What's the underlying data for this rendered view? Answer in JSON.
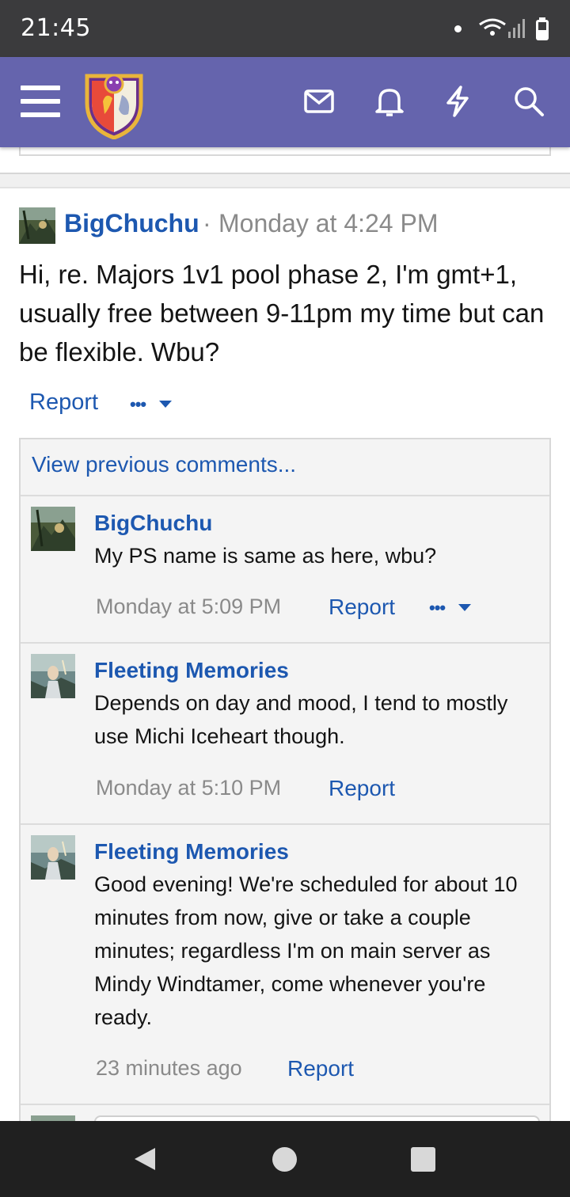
{
  "status_bar": {
    "time": "21:45"
  },
  "app_bar": {
    "icons": [
      "menu-icon",
      "site-logo",
      "mail-icon",
      "bell-icon",
      "lightning-icon",
      "search-icon"
    ],
    "color": "#6564ad"
  },
  "post": {
    "author": "BigChuchu",
    "separator": "·",
    "time": "Monday at 4:24 PM",
    "body": "Hi, re. Majors 1v1 pool phase 2, I'm gmt+1, usually free between 9-11pm my time but can be flexible. Wbu?",
    "report_label": "Report",
    "more_label": "•••"
  },
  "comments": {
    "view_previous": "View previous comments...",
    "items": [
      {
        "author": "BigChuchu",
        "text": "My PS name is same as here, wbu?",
        "time": "Monday at 5:09 PM",
        "report_label": "Report",
        "more_label": "•••"
      },
      {
        "author": "Fleeting Memories",
        "text": "Depends on day and mood, I tend to mostly use Michi Iceheart though.",
        "time": "Monday at 5:10 PM",
        "report_label": "Report"
      },
      {
        "author": "Fleeting Memories",
        "text": "Good evening! We're scheduled for about 10 minutes from now, give or take a couple minutes; regardless I'm on main server as Mindy Windtamer, come whenever you're ready.",
        "time": "23 minutes ago",
        "report_label": "Report"
      }
    ]
  },
  "colors": {
    "link": "#1d58b0",
    "muted": "#8a8a8a",
    "header": "#6564ad"
  }
}
